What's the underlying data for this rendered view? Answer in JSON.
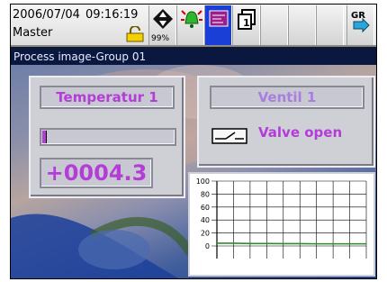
{
  "status": {
    "date": "2006/07/04",
    "time": "09:16:19",
    "user": "Master",
    "memory_percent": "99%"
  },
  "toolbar": {
    "active_button": "screen-button"
  },
  "screen": {
    "title": "Process image-Group 01"
  },
  "temperature": {
    "label": "Temperatur 1",
    "level_fraction": 0.03,
    "value": "+0004.3"
  },
  "valve": {
    "label": "Ventil 1",
    "state": "Valve open"
  },
  "trend": {
    "y_ticks": [
      "100",
      "80",
      "60",
      "40",
      "20",
      "0"
    ]
  },
  "chart_data": {
    "type": "line",
    "xlabel": "",
    "ylabel": "",
    "ylim": [
      0,
      100
    ],
    "grid": true,
    "x": [
      0,
      1,
      2,
      3,
      4,
      5,
      6,
      7,
      8,
      9
    ],
    "series": [
      {
        "values": [
          4.3,
          4.3,
          3.8,
          3.8,
          3.6,
          3.6,
          3.3,
          3.3,
          3.3,
          3.3
        ]
      }
    ]
  },
  "colors": {
    "accent": "#b43cd7",
    "trend_line": "#2e8b2e",
    "active_button": "#1a3fd6"
  }
}
